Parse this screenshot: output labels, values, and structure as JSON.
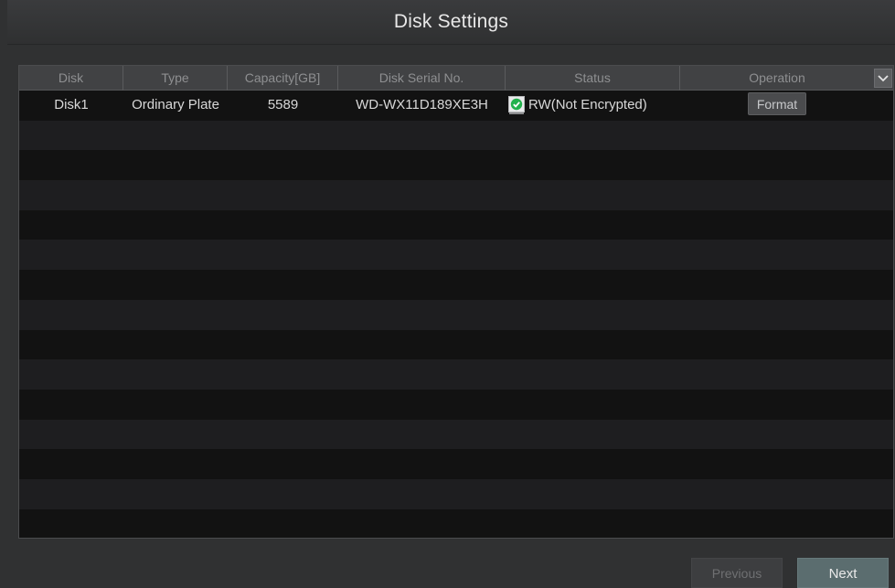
{
  "header": {
    "title": "Disk Settings"
  },
  "table": {
    "columns": [
      "Disk",
      "Type",
      "Capacity[GB]",
      "Disk Serial No.",
      "Status",
      "Operation"
    ],
    "column_menu_icon": "chevron-down-icon",
    "rows": [
      {
        "disk": "Disk1",
        "type": "Ordinary Plate",
        "capacity": "5589",
        "serial": "WD-WX11D189XE3H",
        "status": "RW(Not Encrypted)",
        "status_icon": "check-circle-icon",
        "status_color": "#22b14c",
        "operation_label": "Format"
      }
    ],
    "empty_row_count": 14
  },
  "footer": {
    "previous_label": "Previous",
    "next_label": "Next"
  },
  "colors": {
    "background": "#303132",
    "table_background": "#1b1b1c",
    "header_row": "#414244",
    "next_button": "#5b6d6f"
  }
}
